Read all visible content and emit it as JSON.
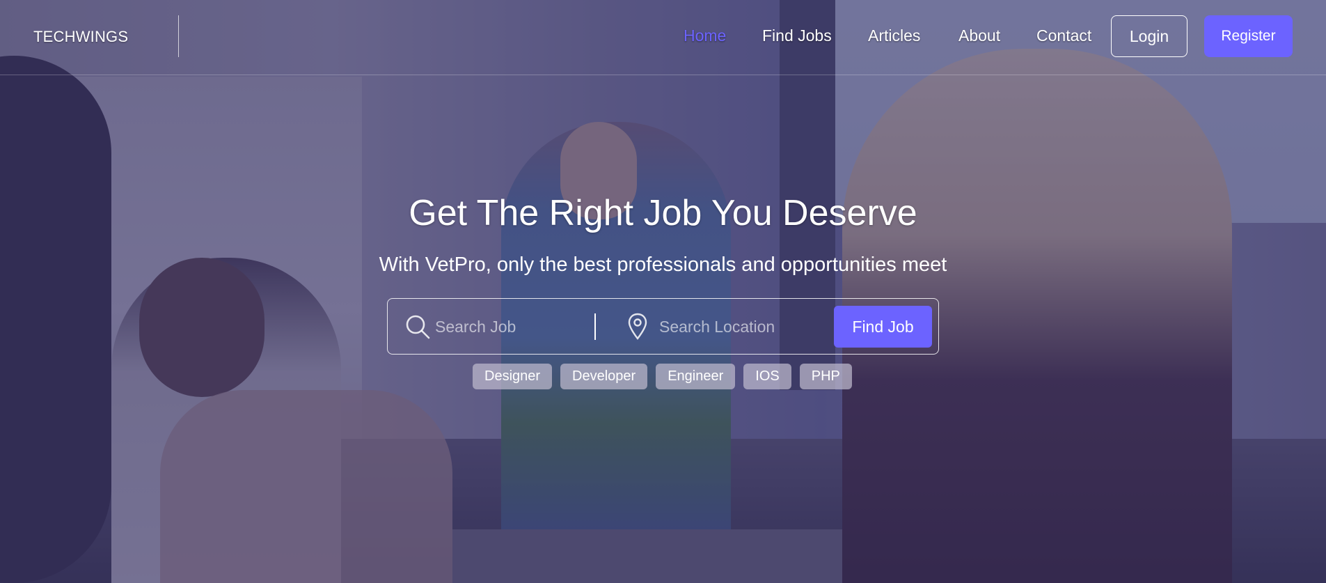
{
  "header": {
    "brand": "TECHWINGS",
    "nav": [
      {
        "label": "Home",
        "active": true
      },
      {
        "label": "Find Jobs",
        "active": false
      },
      {
        "label": "Articles",
        "active": false
      },
      {
        "label": "About",
        "active": false
      },
      {
        "label": "Contact",
        "active": false
      }
    ],
    "login_label": "Login",
    "register_label": "Register"
  },
  "hero": {
    "title": "Get The Right Job You Deserve",
    "subtitle": "With VetPro, only the best professionals and opportunities meet"
  },
  "search": {
    "job_placeholder": "Search Job",
    "job_icon": "search-icon",
    "location_placeholder": "Search Location",
    "location_icon": "location-pin-icon",
    "button_label": "Find Job"
  },
  "tags": [
    "Designer",
    "Developer",
    "Engineer",
    "IOS",
    "PHP"
  ],
  "colors": {
    "accent": "#6c63ff",
    "overlay": "#2a2458"
  }
}
